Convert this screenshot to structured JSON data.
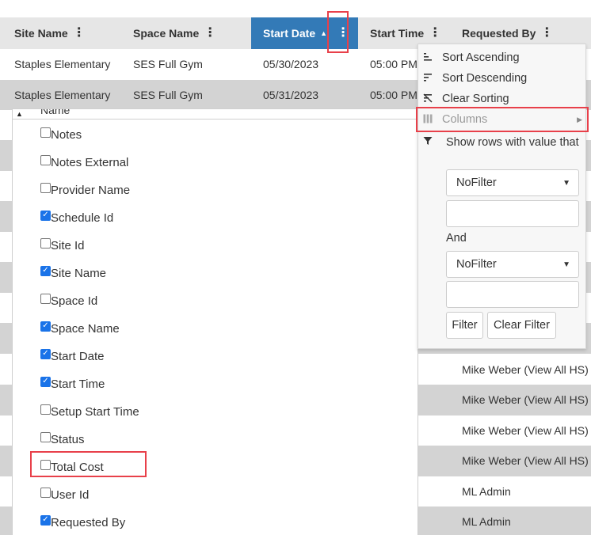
{
  "header": {
    "columns": [
      {
        "label": "Site Name"
      },
      {
        "label": "Space Name"
      },
      {
        "label": "Start Date",
        "sort_arrow": "▲"
      },
      {
        "label": "Start Time"
      },
      {
        "label": "Requested By"
      }
    ],
    "kebab": "⋮"
  },
  "rows": [
    {
      "site": "Staples Elementary",
      "space": "SES Full Gym",
      "date": "05/30/2023",
      "time": "05:00 PM"
    },
    {
      "site": "Staples Elementary",
      "space": "SES Full Gym",
      "date": "05/31/2023",
      "time": "05:00 PM"
    }
  ],
  "requested_by_visible": [
    "",
    "",
    "",
    "",
    "",
    "",
    "",
    "",
    "Mike Weber (View All HS)",
    "Mike Weber (View All HS)",
    "Mike Weber (View All HS)",
    "Mike Weber (View All HS)",
    "ML Admin",
    "ML Admin"
  ],
  "column_chooser": {
    "partial_label": "Name",
    "items": [
      {
        "label": "Notes",
        "checked": false
      },
      {
        "label": "Notes External",
        "checked": false
      },
      {
        "label": "Provider Name",
        "checked": false
      },
      {
        "label": "Schedule Id",
        "checked": true
      },
      {
        "label": "Site Id",
        "checked": false
      },
      {
        "label": "Site Name",
        "checked": true
      },
      {
        "label": "Space Id",
        "checked": false
      },
      {
        "label": "Space Name",
        "checked": true
      },
      {
        "label": "Start Date",
        "checked": true
      },
      {
        "label": "Start Time",
        "checked": true
      },
      {
        "label": "Setup Start Time",
        "checked": false
      },
      {
        "label": "Status",
        "checked": false
      },
      {
        "label": "Total Cost",
        "checked": false
      },
      {
        "label": "User Id",
        "checked": false
      },
      {
        "label": "Requested By",
        "checked": true
      }
    ]
  },
  "menu": {
    "sort_ascending": "Sort Ascending",
    "sort_descending": "Sort Descending",
    "clear_sorting": "Clear Sorting",
    "columns": "Columns",
    "filter_title": "Show rows with value that",
    "select1": "NoFilter",
    "and_label": "And",
    "select2": "NoFilter",
    "filter_button": "Filter",
    "clear_filter_button": "Clear Filter"
  },
  "colors": {
    "header_bg": "#e6e6e6",
    "active_header_bg": "#337ab7",
    "alt_row_bg": "#d3d3d3",
    "highlight": "#e8404a",
    "checkbox_checked": "#1a73e8"
  }
}
